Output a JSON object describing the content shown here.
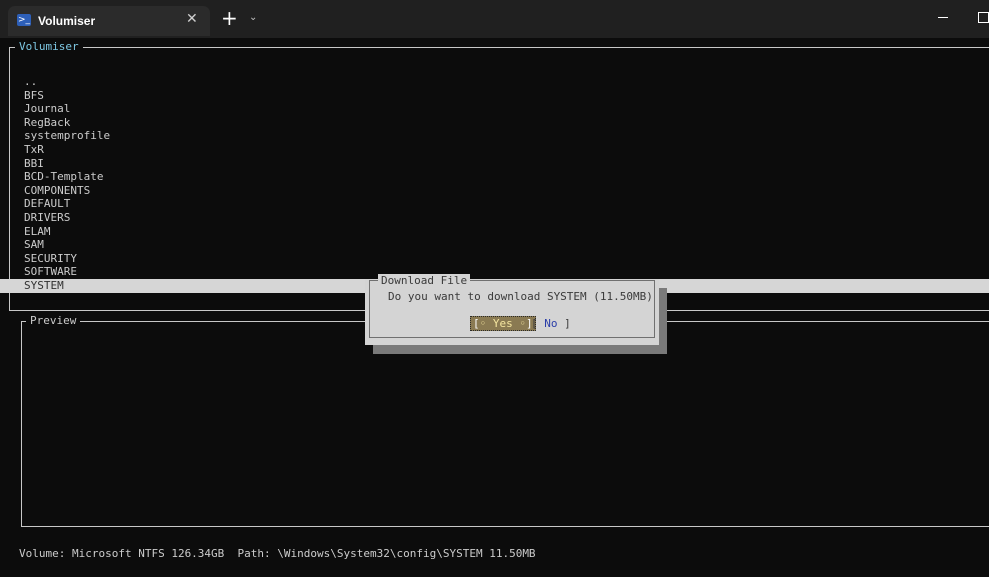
{
  "window": {
    "tab_title": "Volumiser",
    "tab_close": "✕",
    "new_tab": "+",
    "dropdown": "⌄"
  },
  "main_panel": {
    "title": "Volumiser",
    "items": [
      "..",
      "BFS",
      "Journal",
      "RegBack",
      "systemprofile",
      "TxR",
      "BBI",
      "BCD-Template",
      "COMPONENTS",
      "DEFAULT",
      "DRIVERS",
      "ELAM",
      "SAM",
      "SECURITY",
      "SOFTWARE",
      "SYSTEM"
    ],
    "selected_index": 15
  },
  "preview_panel": {
    "title": "Preview"
  },
  "dialog": {
    "title": "Download File",
    "message": "Do you want to download SYSTEM (11.50MB)",
    "yes_label": "Yes",
    "no_label": "No",
    "focused": "yes"
  },
  "status": {
    "text": "Volume: Microsoft NTFS 126.34GB  Path: \\Windows\\System32\\config\\SYSTEM 11.50MB"
  },
  "colors": {
    "background": "#0c0c0c",
    "panel_title": "#7ec8e3",
    "selection_bg": "#d6d6d6",
    "dialog_bg": "#d4d4d4",
    "focused_button_bg": "#8a7a52",
    "no_button_text": "#2b3ea8"
  },
  "icons": {
    "tab": "powershell-icon",
    "window_controls": [
      "minimize-icon",
      "maximize-icon"
    ]
  }
}
